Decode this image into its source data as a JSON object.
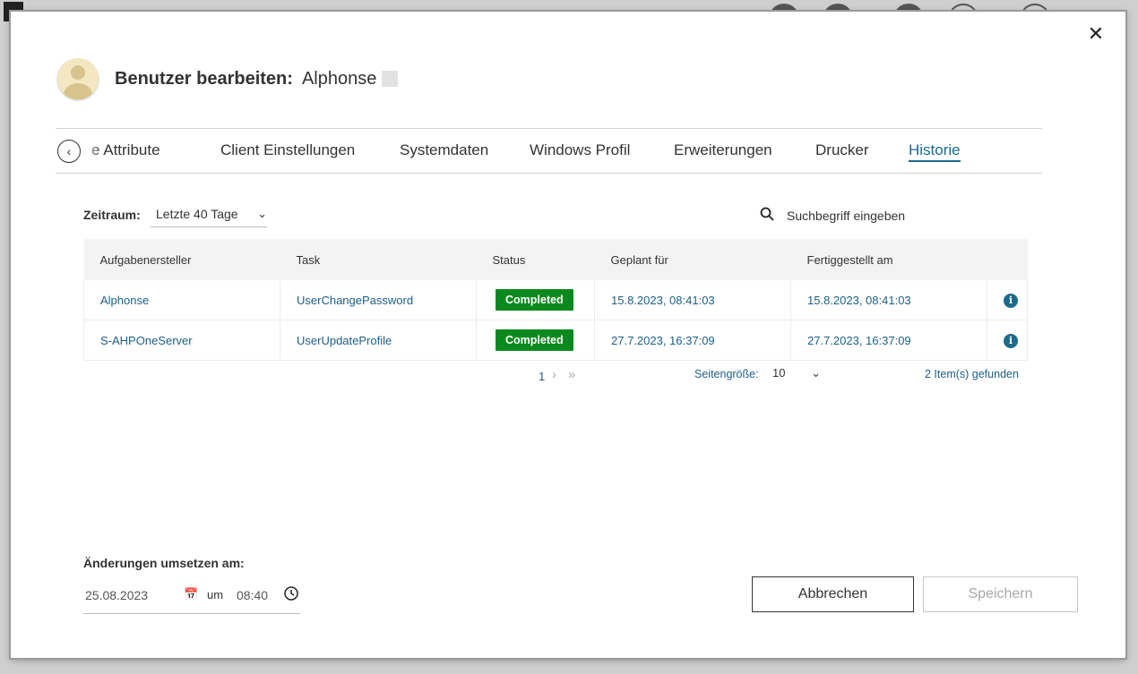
{
  "dialog": {
    "title": "Benutzer bearbeiten:",
    "user_name": "Alphonse",
    "close_glyph": "✕"
  },
  "tabs": [
    {
      "label": "e Attribute"
    },
    {
      "label": "Client Einstellungen"
    },
    {
      "label": "Systemdaten"
    },
    {
      "label": "Windows Profil"
    },
    {
      "label": "Erweiterungen"
    },
    {
      "label": "Drucker"
    },
    {
      "label": "Historie",
      "active": true
    }
  ],
  "filter": {
    "label": "Zeitraum:",
    "value": "Letzte 40 Tage"
  },
  "search": {
    "placeholder": "Suchbegriff eingeben"
  },
  "table": {
    "headers": [
      "Aufgabenersteller",
      "Task",
      "Status",
      "Geplant für",
      "Fertiggestellt am"
    ],
    "rows": [
      {
        "creator": "Alphonse",
        "task": "UserChangePassword",
        "status": "Completed",
        "planned": "15.8.2023, 08:41:03",
        "completed": "15.8.2023, 08:41:03"
      },
      {
        "creator": "S-AHPOneServer",
        "task": "UserUpdateProfile",
        "status": "Completed",
        "planned": "27.7.2023, 16:37:09",
        "completed": "27.7.2023, 16:37:09"
      }
    ],
    "status_color": "#0a8a1e"
  },
  "pager": {
    "current_page": "1",
    "page_size_label": "Seitengröße:",
    "page_size": "10",
    "items_found": "2 Item(s) gefunden"
  },
  "apply": {
    "label": "Änderungen umsetzen am:",
    "date": "25.08.2023",
    "um": "um",
    "time": "08:40"
  },
  "buttons": {
    "cancel": "Abbrechen",
    "save": "Speichern"
  },
  "colors": {
    "accent": "#1d6a8c"
  }
}
